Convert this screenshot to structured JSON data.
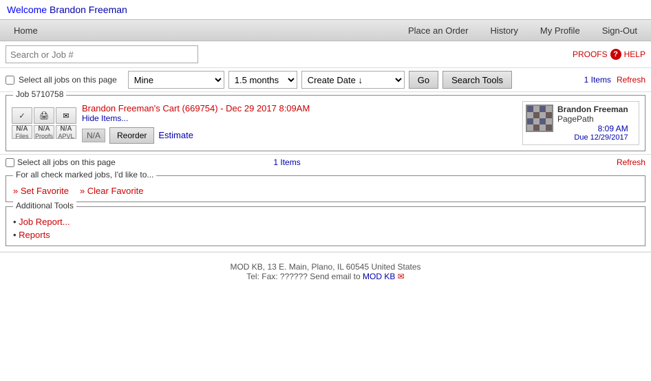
{
  "welcome": {
    "text": "Welcome",
    "user": "Brandon Freeman"
  },
  "nav": {
    "left": [
      "Home"
    ],
    "right": [
      "Place an Order",
      "History",
      "My Profile",
      "Sign-Out"
    ]
  },
  "search": {
    "placeholder": "Search or Job #",
    "proofs_label": "PROOFS",
    "help_label": "HELP"
  },
  "filters": {
    "mine_options": [
      "Mine"
    ],
    "mine_selected": "Mine",
    "months_options": [
      "1.5 months"
    ],
    "months_selected": "1.5 months",
    "date_options": [
      "Create Date ↓"
    ],
    "date_selected": "Create Date ↓",
    "go_label": "Go",
    "search_tools_label": "Search Tools"
  },
  "items_bar": {
    "select_all_label": "Select all jobs on this page",
    "count": "1 Items",
    "refresh_label": "Refresh"
  },
  "job": {
    "id_label": "Job 5710758",
    "title": "Brandon Freeman's Cart (669754) - Dec 29 2017 8:09AM",
    "hide_label": "Hide Items...",
    "na_label": "N/A",
    "files_label": "Files",
    "proofs_label": "Proofs",
    "apvl_label": "APVL",
    "reorder_label": "Reorder",
    "estimate_label": "Estimate",
    "thumb": {
      "name": "Brandon Freeman",
      "sub": "PagePath",
      "time": "8:09 AM",
      "due": "Due 12/29/2017"
    }
  },
  "checked_jobs": {
    "title": "For all check marked jobs, I'd like to...",
    "links": [
      "Set Favorite",
      "Clear Favorite"
    ]
  },
  "additional_tools": {
    "title": "Additional Tools",
    "links": [
      "Job Report...",
      "Reports"
    ]
  },
  "footer": {
    "line1": "MOD KB, 13 E. Main, Plano, IL 60545 United States",
    "line2_pre": "Tel: Fax: ?????? Send email to ",
    "line2_link": "MOD KB"
  }
}
